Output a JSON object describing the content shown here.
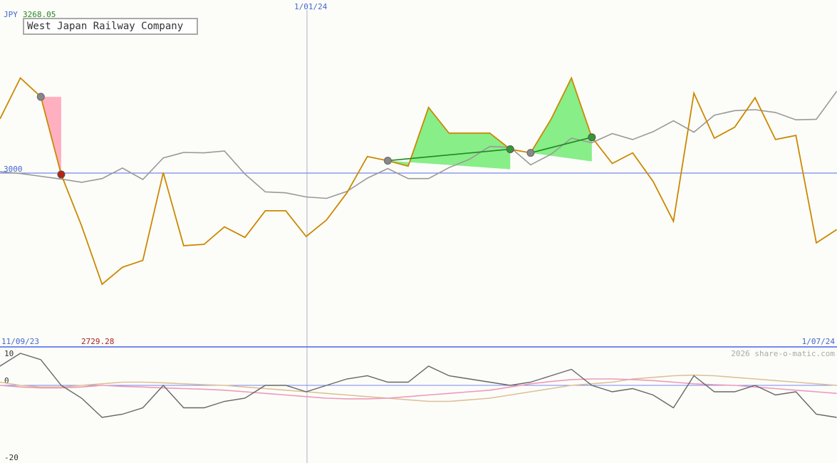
{
  "header": {
    "currency": "JPY",
    "high_value": "3268.05",
    "company_name": "West Japan Railway Company",
    "ref_level_label": "3000",
    "low_value": "2729.28",
    "start_date": "11/09/23",
    "mid_date": "1/01/24",
    "end_date": "1/07/24",
    "watermark": "2026 share-o-matic.com",
    "osc_top": "10",
    "osc_zero": "0",
    "osc_bottom": "-20"
  },
  "colors": {
    "price": "#cc8800",
    "average": "#999999",
    "reference": "#7788ee",
    "gain_fill": "#88ee88",
    "loss_fill": "#ffb0c0",
    "trade_line": "#228822",
    "osc_main": "#666666",
    "osc_pink": "#ee99bb",
    "osc_tan": "#ddc099"
  },
  "chart_data": [
    {
      "type": "line",
      "title": "West Japan Railway Company",
      "ylabel": "JPY",
      "ylim": [
        2729.28,
        3268.05
      ],
      "reference_level": 3000,
      "x_start": "11/09/23",
      "x_marker": "1/01/24",
      "x_end": "1/07/24",
      "series": [
        {
          "values": [
            3118,
            3207,
            3166,
            2997,
            2885,
            2758,
            2795,
            2810,
            3001,
            2842,
            2845,
            2883,
            2860,
            2918,
            2918,
            2862,
            2898,
            2957,
            3036,
            3027,
            3015,
            3143,
            3087,
            3087,
            3087,
            3052,
            3044,
            3117,
            3207,
            3078,
            3021,
            3044,
            2982,
            2895,
            3174,
            3076,
            3100,
            3164,
            3073,
            3082,
            2848,
            2877
          ]
        },
        {
          "values": [
            3003,
            2999,
            2993,
            2987,
            2980,
            2988,
            3011,
            2986,
            3033,
            3045,
            3044,
            3048,
            2998,
            2959,
            2957,
            2948,
            2945,
            2960,
            2989,
            3010,
            2988,
            2988,
            3012,
            3030,
            3058,
            3056,
            3018,
            3041,
            3076,
            3066,
            3086,
            3073,
            3090,
            3114,
            3089,
            3126,
            3136,
            3138,
            3132,
            3116,
            3117,
            3178
          ]
        }
      ],
      "trades": [
        {
          "from_index": 2,
          "to_index": 3,
          "from_value": 3166,
          "to_value": 2997,
          "result": "loss"
        },
        {
          "from_index": 19,
          "to_index": 25,
          "from_value": 3027,
          "to_value": 3052,
          "result": "gain"
        },
        {
          "from_index": 26,
          "to_index": 29,
          "from_value": 3044,
          "to_value": 3078,
          "result": "gain"
        }
      ]
    },
    {
      "type": "line",
      "ylim": [
        -20,
        10
      ],
      "yticks": [
        10,
        0,
        -20
      ],
      "series": [
        {
          "values": [
            6,
            10,
            8,
            0,
            -4,
            -10,
            -9,
            -7,
            0,
            -7,
            -7,
            -5,
            -4,
            0,
            0,
            -2,
            0,
            2,
            3,
            1,
            1,
            6,
            3,
            2,
            1,
            0,
            1,
            3,
            5,
            0,
            -2,
            -1,
            -3,
            -7,
            3,
            -2,
            -2,
            0,
            -3,
            -2,
            -9,
            -10
          ]
        },
        {
          "values": [
            0,
            -0.5,
            -0.8,
            -0.8,
            -0.5,
            0,
            -0.3,
            -0.5,
            -0.8,
            -1,
            -1.2,
            -1.5,
            -2,
            -2.5,
            -3,
            -3.5,
            -4,
            -4.2,
            -4.2,
            -4,
            -3.5,
            -3,
            -2.5,
            -2,
            -1.5,
            -0.5,
            0.5,
            1.2,
            1.8,
            2,
            2,
            1.8,
            1.5,
            1,
            0.5,
            0.2,
            0,
            -0.5,
            -1,
            -1.5,
            -2,
            -2.5
          ]
        },
        {
          "values": [
            1,
            0,
            -0.5,
            -0.5,
            0,
            0.5,
            1,
            1,
            0.8,
            0.5,
            0.2,
            0,
            -0.5,
            -1,
            -1.5,
            -2,
            -2.5,
            -3,
            -3.5,
            -4,
            -4.5,
            -5,
            -5,
            -4.5,
            -4,
            -3,
            -2,
            -1,
            0,
            0.5,
            1,
            2,
            2.5,
            3,
            3.2,
            3,
            2.5,
            2,
            1.5,
            1,
            0.5,
            0
          ]
        }
      ]
    }
  ]
}
